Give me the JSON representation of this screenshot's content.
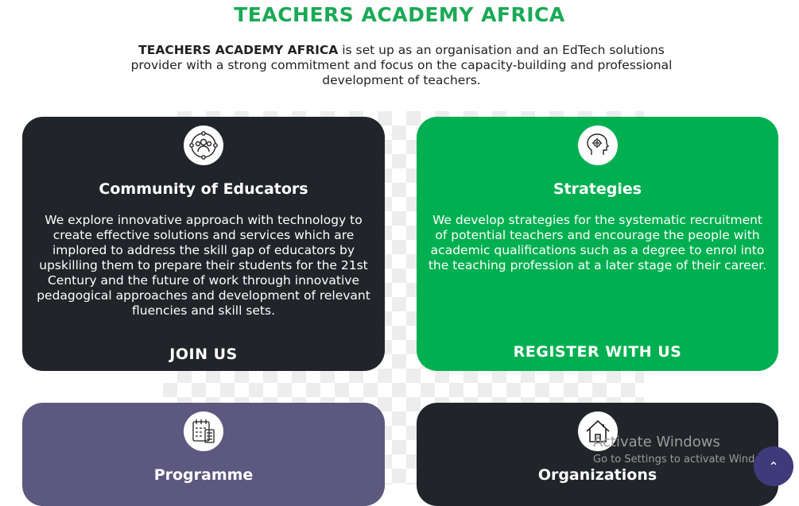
{
  "header": {
    "title": "TEACHERS ACADEMY AFRICA",
    "intro_bold": "TEACHERS ACADEMY AFRICA",
    "intro_rest": " is set up as an organisation and an EdTech solutions provider with a strong commitment and focus on the capacity-building and professional development of teachers."
  },
  "cards": [
    {
      "title": "Community of Educators",
      "text": "We explore innovative approach with technology to create effective solutions and services which are implored to address the skill gap of educators by upskilling them to prepare their students for the 21st Century and the future of work through innovative pedagogical approaches and development of relevant fluencies and skill sets.",
      "cta": "JOIN US",
      "icon": "community-icon",
      "color": "#212529"
    },
    {
      "title": "Strategies",
      "text": "We develop strategies for the systematic recruitment of potential teachers and encourage the people with academic qualifications such as a degree to enrol into the teaching profession at a later stage of their career.",
      "cta": "REGISTER WITH US",
      "icon": "strategy-head-icon",
      "color": "#00b050"
    },
    {
      "title": "Programme",
      "icon": "calendar-checklist-icon",
      "color": "#5d5880"
    },
    {
      "title": "Organizations",
      "icon": "house-icon",
      "color": "#212529"
    }
  ],
  "overlay": {
    "activate_title": "Activate Windows",
    "activate_sub": "Go to Settings to activate Windows.",
    "scroll_top_glyph": "⌃"
  },
  "colors": {
    "brand_green": "#1aaa55",
    "card_green": "#00b050",
    "card_dark": "#212529",
    "card_purple": "#5d5880"
  }
}
